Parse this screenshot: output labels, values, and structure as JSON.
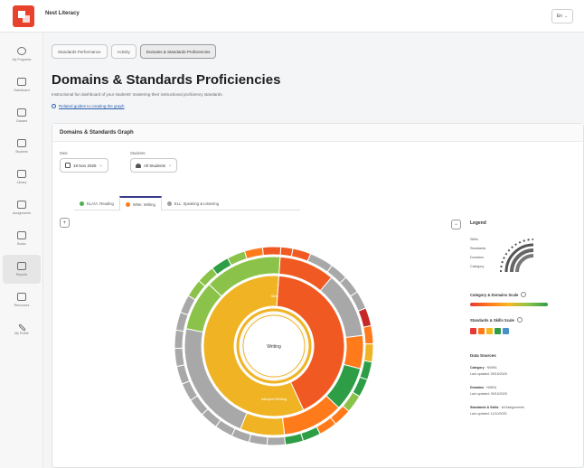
{
  "app": {
    "title": "Nest Literacy",
    "language": "En"
  },
  "sidebar": {
    "items": [
      {
        "label": "My Programs",
        "icon": "refresh-icon"
      },
      {
        "label": "Dashboard",
        "icon": "dashboard-icon"
      },
      {
        "label": "Classes",
        "icon": "classes-icon"
      },
      {
        "label": "Students",
        "icon": "students-icon"
      },
      {
        "label": "Library",
        "icon": "library-icon"
      },
      {
        "label": "Assignments",
        "icon": "assignments-icon"
      },
      {
        "label": "Books",
        "icon": "books-icon"
      },
      {
        "label": "Reports",
        "icon": "reports-icon",
        "active": true
      },
      {
        "label": "Resources",
        "icon": "resources-icon"
      },
      {
        "label": "My Profile",
        "icon": "profile-icon"
      }
    ]
  },
  "report_tabs": [
    {
      "label": "Standards Performance",
      "active": false
    },
    {
      "label": "Activity",
      "active": false
    },
    {
      "label": "Domains & Standards Proficiencies",
      "active": true
    }
  ],
  "page": {
    "title": "Domains & Standards Proficiencies",
    "description": "Instructional fun dashboard of your students' mastering their instructional proficiency standards.",
    "link": "Related guides to creating the graph"
  },
  "card": {
    "title": "Domains & Standards Graph",
    "filters": {
      "date_label": "Date",
      "date_value": "19 Nov 2025",
      "students_label": "Students",
      "students_value": "All Students"
    },
    "subtabs": [
      {
        "label": "ELA/A: Reading",
        "color": "#4caf50",
        "active": false
      },
      {
        "label": "Write: Writing",
        "color": "#ff7a1a",
        "active": true
      },
      {
        "label": "ELL: Speaking & Listening",
        "color": "#9e9e9e",
        "active": false
      }
    ]
  },
  "chart_data": {
    "type": "sunburst",
    "center_label": "Writing",
    "rings": [
      {
        "name": "Domain",
        "segments": [
          {
            "label": "Skill",
            "value": 42,
            "color": "#f05a22"
          },
          {
            "label": "Interpret Writing",
            "value": 58,
            "color": "#f0b323"
          }
        ]
      },
      {
        "name": "Standards",
        "segments": [
          {
            "value": 10,
            "color": "#f05a22"
          },
          {
            "value": 12,
            "color": "#a8a8a8"
          },
          {
            "value": 6,
            "color": "#ff7a1a"
          },
          {
            "value": 8,
            "color": "#2e9e46"
          },
          {
            "value": 11,
            "color": "#ff7a1a"
          },
          {
            "value": 8,
            "color": "#f0b323"
          },
          {
            "value": 22,
            "color": "#a8a8a8"
          },
          {
            "value": 9,
            "color": "#8bc34a"
          },
          {
            "value": 14,
            "color": "#8bc34a"
          }
        ]
      },
      {
        "name": "Skills",
        "segments": [
          {
            "value": 2,
            "color": "#f05a22"
          },
          {
            "value": 3,
            "color": "#f05a22"
          },
          {
            "value": 4,
            "color": "#a8a8a8"
          },
          {
            "value": 3,
            "color": "#a8a8a8"
          },
          {
            "value": 3,
            "color": "#a8a8a8"
          },
          {
            "value": 3,
            "color": "#a8a8a8"
          },
          {
            "value": 3,
            "color": "#c62828"
          },
          {
            "value": 3,
            "color": "#ff7a1a"
          },
          {
            "value": 3,
            "color": "#f0b323"
          },
          {
            "value": 3,
            "color": "#2e9e46"
          },
          {
            "value": 3,
            "color": "#2e9e46"
          },
          {
            "value": 3,
            "color": "#8bc34a"
          },
          {
            "value": 3,
            "color": "#ff7a1a"
          },
          {
            "value": 3,
            "color": "#ff7a1a"
          },
          {
            "value": 3,
            "color": "#2e9e46"
          },
          {
            "value": 3,
            "color": "#2e9e46"
          },
          {
            "value": 3,
            "color": "#a8a8a8"
          },
          {
            "value": 3,
            "color": "#a8a8a8"
          },
          {
            "value": 3,
            "color": "#a8a8a8"
          },
          {
            "value": 3,
            "color": "#a8a8a8"
          },
          {
            "value": 3,
            "color": "#a8a8a8"
          },
          {
            "value": 3,
            "color": "#a8a8a8"
          },
          {
            "value": 3,
            "color": "#a8a8a8"
          },
          {
            "value": 3,
            "color": "#a8a8a8"
          },
          {
            "value": 3,
            "color": "#a8a8a8"
          },
          {
            "value": 3,
            "color": "#a8a8a8"
          },
          {
            "value": 3,
            "color": "#a8a8a8"
          },
          {
            "value": 3,
            "color": "#a8a8a8"
          },
          {
            "value": 3,
            "color": "#8bc34a"
          },
          {
            "value": 3,
            "color": "#8bc34a"
          },
          {
            "value": 3,
            "color": "#2e9e46"
          },
          {
            "value": 3,
            "color": "#8bc34a"
          },
          {
            "value": 3,
            "color": "#ff7a1a"
          },
          {
            "value": 3,
            "color": "#f05a22"
          }
        ]
      }
    ]
  },
  "legend": {
    "title": "Legend",
    "ring_labels": [
      "Skills",
      "Standards",
      "Domains",
      "Category"
    ],
    "category_scale_label": "Category & Domains Scale",
    "skills_scale_label": "Standards & Skills Scale",
    "scale_colors": [
      "#e53935",
      "#ff7a1a",
      "#f5b821",
      "#2e9e46",
      "#4a90c8"
    ],
    "data_sources": {
      "heading": "Data Sources",
      "entries": [
        {
          "name": "Category",
          "source": "NWEA",
          "updated": "Last updated: 09/15/2025"
        },
        {
          "name": "Domains",
          "source": "NWEA",
          "updated": "Last updated: 09/15/2025"
        },
        {
          "name": "Standards & Skills",
          "source": "All Assignments",
          "updated": "Last updated: 11/10/2025"
        }
      ]
    }
  }
}
